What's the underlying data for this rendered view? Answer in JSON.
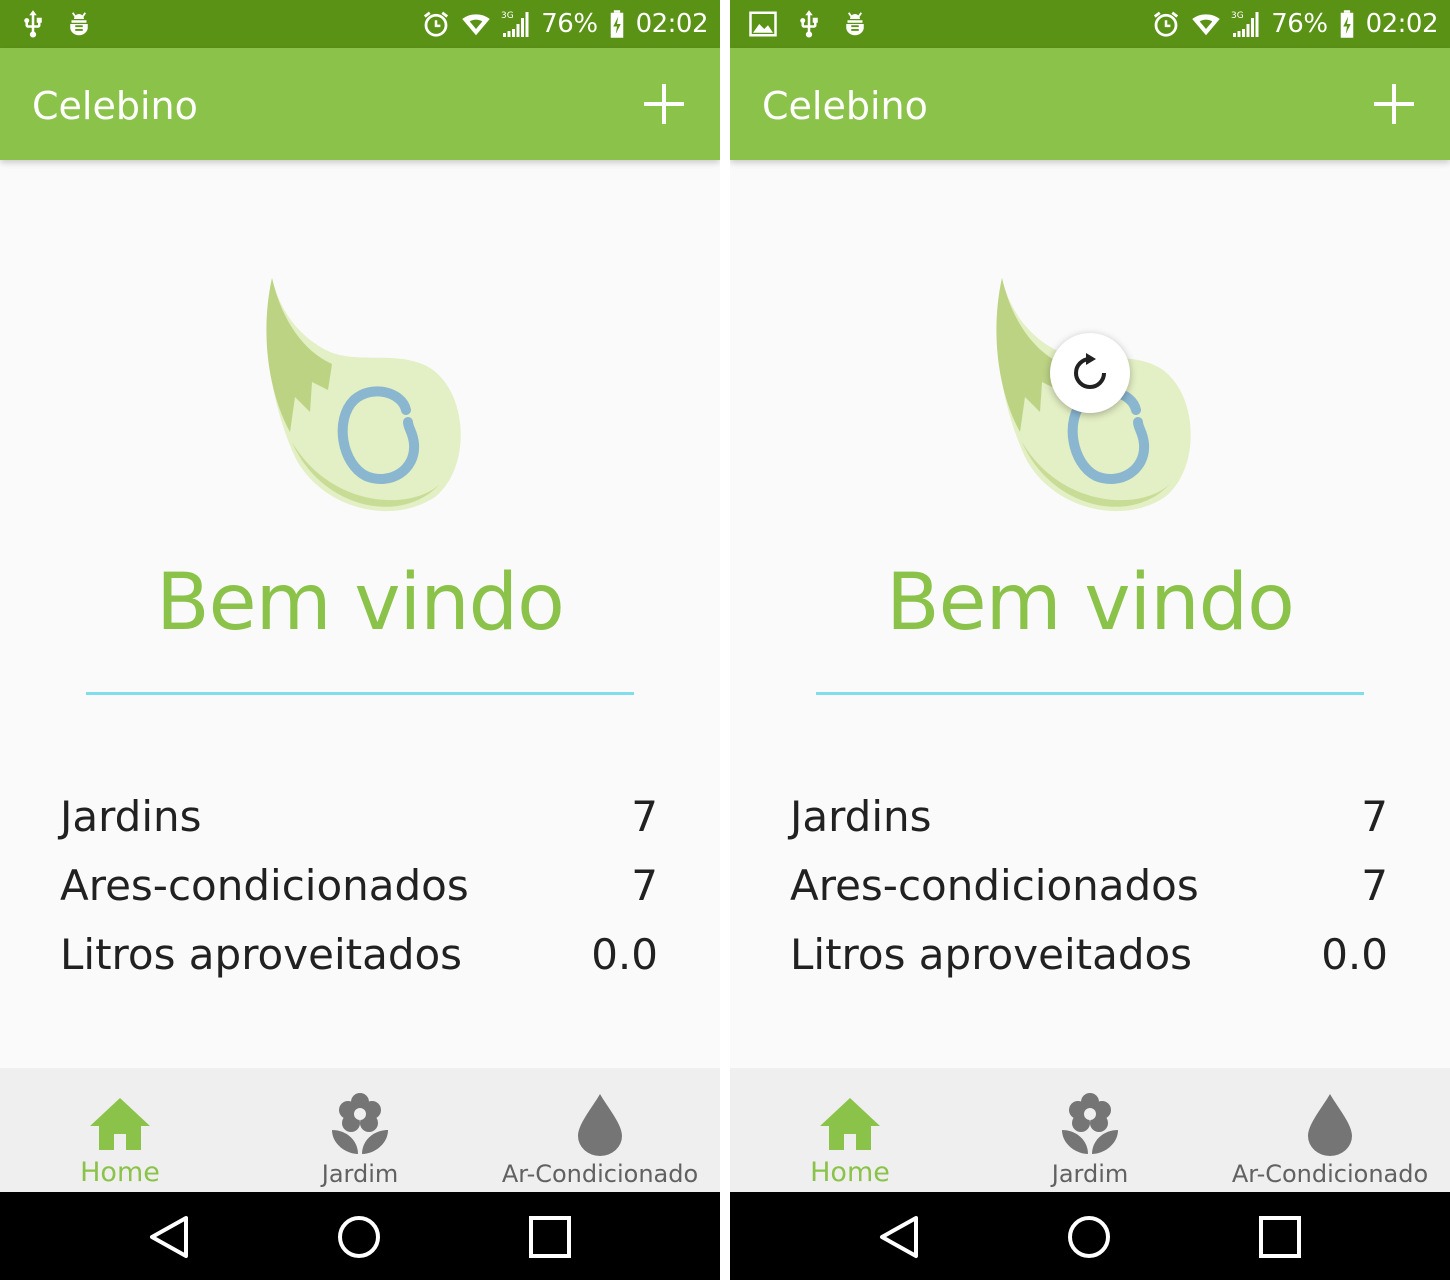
{
  "colors": {
    "status_bar": "#5a9216",
    "app_bar": "#8bc34a",
    "accent": "#8bc34a",
    "divider": "#80deea",
    "background": "#fafafa",
    "bottom_nav": "#efefef",
    "inactive_icon": "#757575"
  },
  "screens": [
    {
      "status": {
        "left_icons": [
          "usb-icon",
          "android-debug-icon"
        ],
        "right_icons": [
          "alarm-icon",
          "wifi-icon",
          "signal-3g-icon",
          "battery-charging-icon"
        ],
        "network": "3G",
        "battery": "76%",
        "time": "02:02"
      },
      "app_bar": {
        "title": "Celebino",
        "action_icon": "add-icon"
      },
      "welcome": "Bem vindo",
      "stats": [
        {
          "label": "Jardins",
          "value": "7"
        },
        {
          "label": "Ares-condicionados",
          "value": "7"
        },
        {
          "label": "Litros aproveitados",
          "value": "0.0"
        }
      ],
      "nav": [
        {
          "label": "Home",
          "icon": "home-icon",
          "active": true
        },
        {
          "label": "Jardim",
          "icon": "flower-icon",
          "active": false
        },
        {
          "label": "Ar-Condicionado",
          "icon": "water-drop-icon",
          "active": false
        }
      ]
    },
    {
      "status": {
        "left_icons": [
          "image-icon",
          "usb-icon",
          "android-debug-icon"
        ],
        "right_icons": [
          "alarm-icon",
          "wifi-icon",
          "signal-3g-icon",
          "battery-charging-icon"
        ],
        "network": "3G",
        "battery": "76%",
        "time": "02:02"
      },
      "app_bar": {
        "title": "Celebino",
        "action_icon": "add-icon"
      },
      "refresh_icon": "refresh-icon",
      "welcome": "Bem vindo",
      "stats": [
        {
          "label": "Jardins",
          "value": "7"
        },
        {
          "label": "Ares-condicionados",
          "value": "7"
        },
        {
          "label": "Litros aproveitados",
          "value": "0.0"
        }
      ],
      "nav": [
        {
          "label": "Home",
          "icon": "home-icon",
          "active": true
        },
        {
          "label": "Jardim",
          "icon": "flower-icon",
          "active": false
        },
        {
          "label": "Ar-Condicionado",
          "icon": "water-drop-icon",
          "active": false
        }
      ]
    }
  ]
}
